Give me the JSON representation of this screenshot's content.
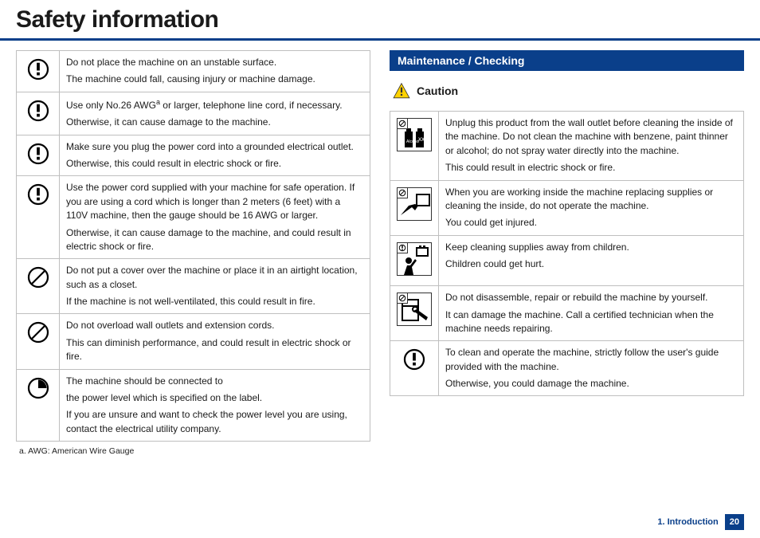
{
  "header": {
    "title": "Safety information"
  },
  "left": {
    "rows": [
      {
        "icon": "warning-circle",
        "p1": "Do not place the machine on an unstable surface.",
        "p2": "The machine could fall, causing injury or machine damage."
      },
      {
        "icon": "warning-circle",
        "p1_pre": "Use only No.26 AWG",
        "p1_sup": "a",
        "p1_post": " or larger, telephone line cord, if necessary.",
        "p2": "Otherwise, it can cause damage to the machine."
      },
      {
        "icon": "warning-circle",
        "p1": "Make sure you plug the power cord into a grounded electrical outlet.",
        "p2": "Otherwise, this could result in electric shock or fire."
      },
      {
        "icon": "warning-circle",
        "p1": "Use the power cord supplied with your machine for safe operation. If you are using a cord which is longer than 2 meters (6 feet) with a 110V machine, then the gauge should be 16 AWG or larger.",
        "p2": "Otherwise, it can cause damage to the machine, and could result in electric shock or fire."
      },
      {
        "icon": "prohibit",
        "p1": "Do not put a cover over the machine or place it in an airtight location, such as a closet.",
        "p2": "If the machine is not well-ventilated, this could result in fire."
      },
      {
        "icon": "prohibit",
        "p1": "Do not overload wall outlets and extension cords.",
        "p2": "This can diminish performance, and could result in electric shock or fire."
      },
      {
        "icon": "must-do",
        "p1": "The machine should be connected to",
        "p2": "the power level which is specified on the label.",
        "p3": "If you are unsure and want to check the power level you are using, contact the electrical utility company."
      }
    ],
    "footnote": "a.  AWG: American Wire Gauge"
  },
  "right": {
    "heading": "Maintenance / Checking",
    "caution": "Caution",
    "rows": [
      {
        "icon": "picto-chemicals",
        "p1": "Unplug this product from the wall outlet before cleaning the inside of the machine. Do not clean the machine with benzene, paint thinner or alcohol; do not spray water directly into the machine.",
        "p2": "This could result in electric shock or fire."
      },
      {
        "icon": "picto-hand",
        "p1": "When you are working inside the machine replacing supplies or cleaning the inside, do not operate the machine.",
        "p2": "You could get injured."
      },
      {
        "icon": "picto-child",
        "p1": "Keep cleaning supplies away from children.",
        "p2": "Children could get hurt."
      },
      {
        "icon": "picto-repair",
        "p1": "Do not disassemble, repair or rebuild the machine by yourself.",
        "p2": "It can damage the machine. Call a certified technician when the machine needs repairing."
      },
      {
        "icon": "warning-circle",
        "p1": "To clean and operate the machine, strictly follow the user's guide provided with the machine.",
        "p2": "Otherwise, you could damage the machine."
      }
    ]
  },
  "footer": {
    "chapter": "1. Introduction",
    "page": "20"
  }
}
